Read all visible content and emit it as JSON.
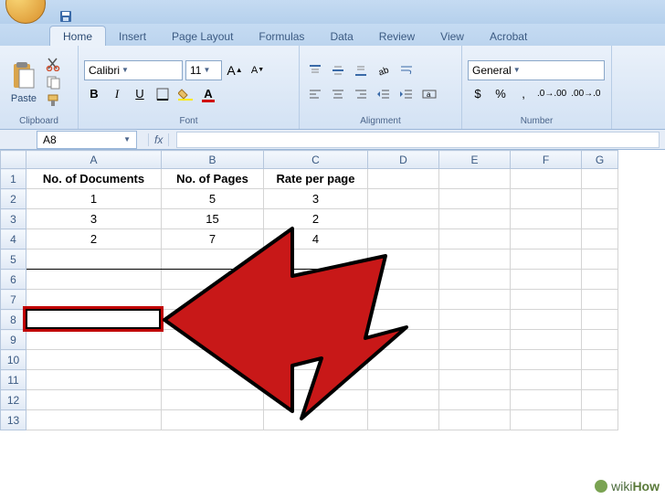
{
  "tabs": {
    "items": [
      "Home",
      "Insert",
      "Page Layout",
      "Formulas",
      "Data",
      "Review",
      "View",
      "Acrobat"
    ],
    "active": 0
  },
  "ribbon": {
    "clipboard": {
      "label": "Clipboard",
      "paste": "Paste"
    },
    "font": {
      "label": "Font",
      "name": "Calibri",
      "size": "11",
      "bold": "B",
      "italic": "I",
      "underline": "U"
    },
    "alignment": {
      "label": "Alignment"
    },
    "number": {
      "label": "Number",
      "format": "General",
      "currency": "$",
      "percent": "%",
      "comma": ","
    }
  },
  "namebox": {
    "ref": "A8"
  },
  "formula_bar": {
    "fx": "fx",
    "value": ""
  },
  "sheet": {
    "columns": [
      "A",
      "B",
      "C",
      "D",
      "E",
      "F",
      "G"
    ],
    "col_widths": [
      "colA",
      "colB",
      "colC",
      "colD",
      "colE",
      "colF",
      "colG"
    ],
    "rows": [
      {
        "n": 1,
        "cells": [
          "No. of Documents",
          "No. of Pages",
          "Rate per page",
          "",
          "",
          "",
          ""
        ],
        "header": true
      },
      {
        "n": 2,
        "cells": [
          "1",
          "5",
          "3",
          "",
          "",
          "",
          ""
        ]
      },
      {
        "n": 3,
        "cells": [
          "3",
          "15",
          "2",
          "",
          "",
          "",
          ""
        ]
      },
      {
        "n": 4,
        "cells": [
          "2",
          "7",
          "4",
          "",
          "",
          "",
          ""
        ]
      },
      {
        "n": 5,
        "cells": [
          "",
          "",
          "",
          "",
          "",
          "",
          ""
        ]
      },
      {
        "n": 6,
        "cells": [
          "",
          "",
          "",
          "",
          "",
          "",
          ""
        ]
      },
      {
        "n": 7,
        "cells": [
          "",
          "",
          "",
          "",
          "",
          "",
          ""
        ]
      },
      {
        "n": 8,
        "cells": [
          "",
          "",
          "",
          "",
          "",
          "",
          ""
        ]
      },
      {
        "n": 9,
        "cells": [
          "",
          "",
          "",
          "",
          "",
          "",
          ""
        ]
      },
      {
        "n": 10,
        "cells": [
          "",
          "",
          "",
          "",
          "",
          "",
          ""
        ]
      },
      {
        "n": 11,
        "cells": [
          "",
          "",
          "",
          "",
          "",
          "",
          ""
        ]
      },
      {
        "n": 12,
        "cells": [
          "",
          "",
          "",
          "",
          "",
          "",
          ""
        ]
      },
      {
        "n": 13,
        "cells": [
          "",
          "",
          "",
          "",
          "",
          "",
          ""
        ]
      }
    ],
    "selected": "A8"
  },
  "watermark": {
    "prefix": "wiki",
    "suffix": "How"
  }
}
